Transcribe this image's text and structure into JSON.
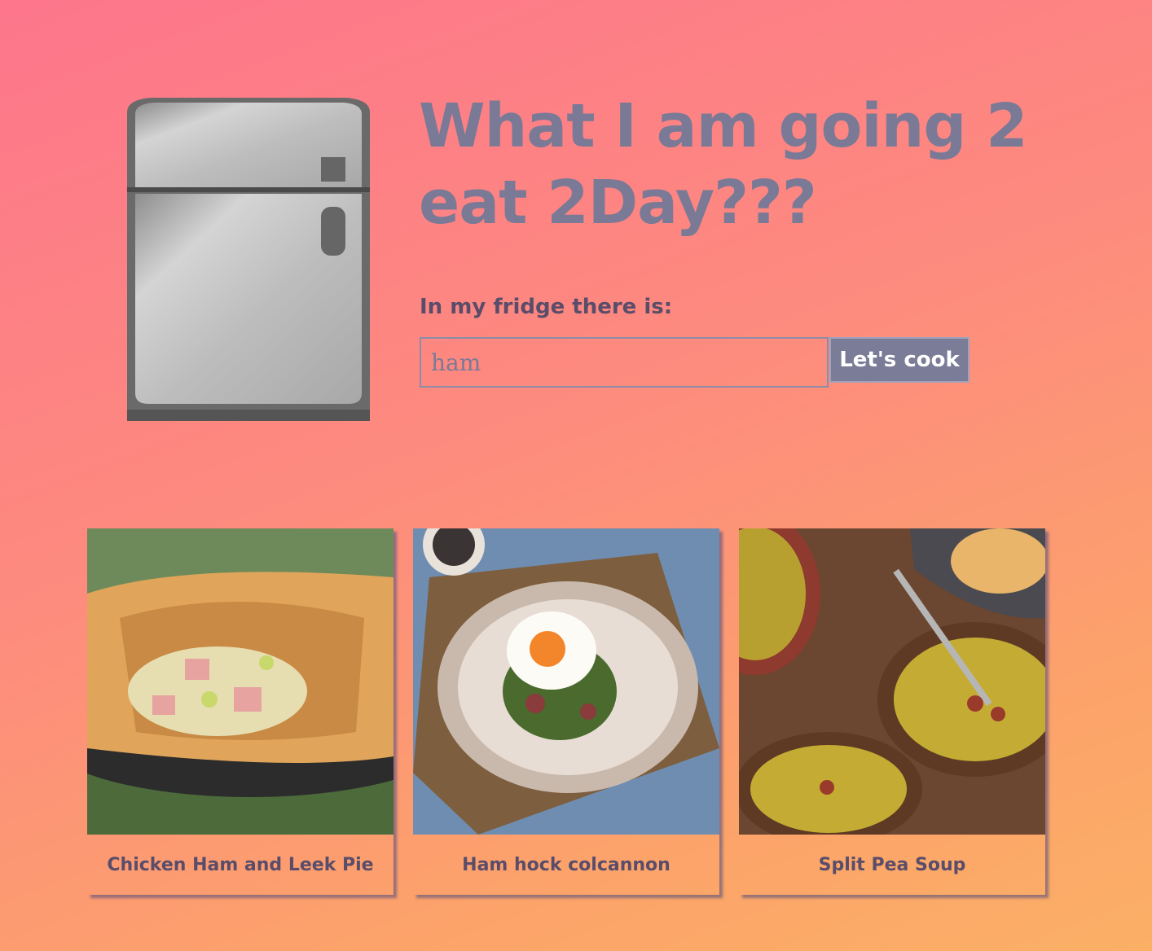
{
  "header": {
    "title": "What I am going 2 eat 2Day???",
    "fridge_label": "In my fridge there is:"
  },
  "search": {
    "value": "",
    "placeholder": "ham",
    "button_label": "Let's cook"
  },
  "recipes": [
    {
      "title": "Chicken Ham and Leek Pie",
      "image": "pie-photo"
    },
    {
      "title": "Ham hock colcannon",
      "image": "egg-dish-photo"
    },
    {
      "title": "Split Pea Soup",
      "image": "soup-photo"
    }
  ],
  "colors": {
    "background_start": "#fd768c",
    "background_end": "#fbb066",
    "title": "#7a7a96",
    "label": "#5a4d6a",
    "button": "#7a7c98"
  }
}
